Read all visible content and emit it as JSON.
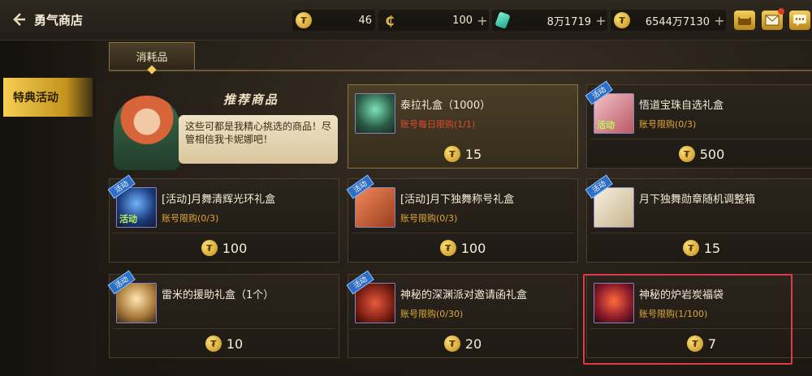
{
  "header": {
    "back_icon": "back-arrow-icon",
    "title": "勇气商店",
    "currencies": [
      {
        "icon": "gold-coin-icon",
        "value": "46",
        "plus": ""
      },
      {
        "icon": "c-currency-icon",
        "symbol": "₵",
        "value": "100",
        "plus": "+"
      },
      {
        "icon": "green-gem-icon",
        "value": "8万1719",
        "plus": "+"
      },
      {
        "icon": "gold-coin-icon",
        "value": "6544万7130",
        "plus": "+"
      }
    ],
    "icons": [
      "wallet-icon",
      "mail-icon",
      "chat-icon"
    ]
  },
  "sidenav": {
    "items": [
      {
        "label": "特典活动",
        "active": true
      }
    ]
  },
  "tabs": [
    {
      "label": "消耗品",
      "active": true
    }
  ],
  "featured": {
    "banner": "推荐商品",
    "speech": "这些可都是我精心挑选的商品！尽管相信我卡妮娜吧！"
  },
  "coin_symbol": "₮",
  "cards": [
    {
      "name": "泰拉礼盒（1000）",
      "limit": "账号每日限购(1/1)",
      "limit_style": "red",
      "price": "15",
      "tag": "",
      "ribbon": "",
      "art": "teal"
    },
    {
      "name": "悟道宝珠自选礼盒",
      "limit": "账号限购(0/3)",
      "limit_style": "gold",
      "price": "500",
      "tag": "活动",
      "ribbon": "活动",
      "art": "pink"
    },
    {
      "name": "[活动]月舞清辉光环礼盒",
      "limit": "账号限购(0/3)",
      "limit_style": "gold",
      "price": "100",
      "tag": "活动",
      "ribbon": "活动",
      "art": "blue"
    },
    {
      "name": "[活动]月下独舞称号礼盒",
      "limit": "账号限购(0/3)",
      "limit_style": "gold",
      "price": "100",
      "tag": "",
      "ribbon": "活动",
      "art": "red"
    },
    {
      "name": "月下独舞勋章随机调整箱",
      "limit": "",
      "limit_style": "gold",
      "price": "15",
      "tag": "",
      "ribbon": "活动",
      "art": "card"
    },
    {
      "name": "雷米的援助礼盒（1个）",
      "limit": "",
      "limit_style": "gold",
      "price": "10",
      "tag": "",
      "ribbon": "活动",
      "art": "wing"
    },
    {
      "name": "神秘的深渊派对邀请函礼盒",
      "limit": "账号限购(0/30)",
      "limit_style": "gold",
      "price": "20",
      "tag": "",
      "ribbon": "活动",
      "art": "chest"
    },
    {
      "name": "神秘的炉岩炭福袋",
      "limit": "账号限购(1/100)",
      "limit_style": "gold",
      "price": "7",
      "tag": "",
      "ribbon": "",
      "art": "bag"
    }
  ]
}
